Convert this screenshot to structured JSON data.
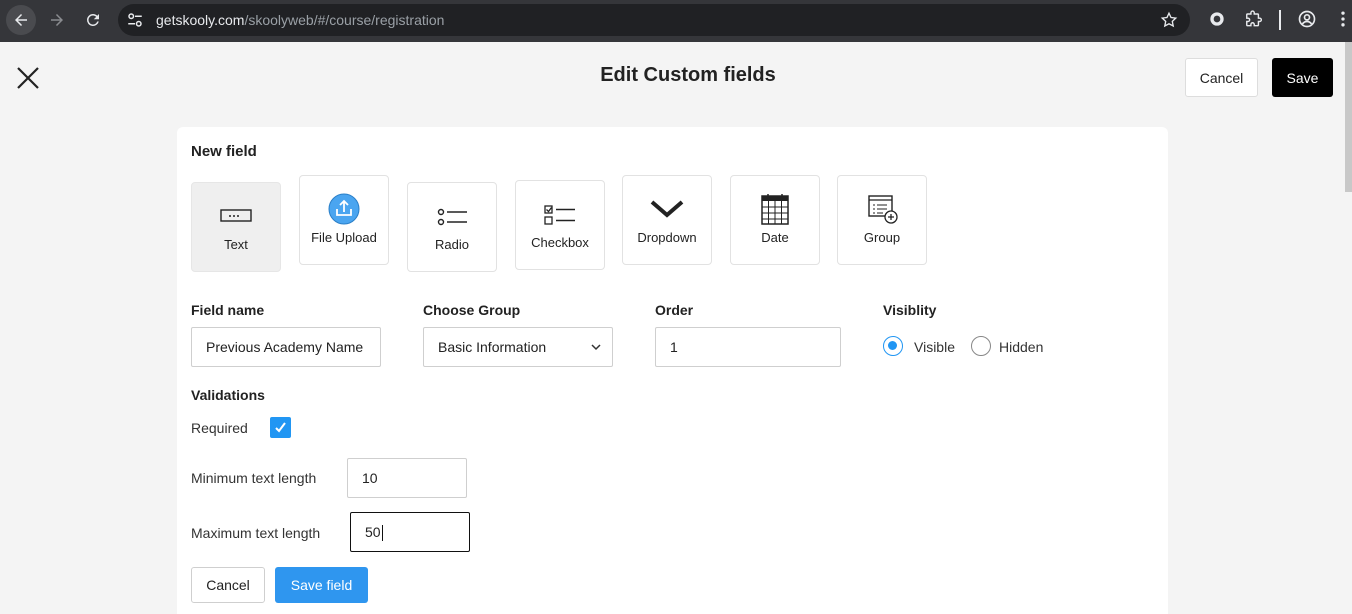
{
  "browser": {
    "url_host": "getskooly.com",
    "url_path": "/skoolyweb/#/course/registration"
  },
  "header": {
    "title": "Edit Custom fields",
    "cancel_label": "Cancel",
    "save_label": "Save"
  },
  "new_field": {
    "heading": "New field",
    "types": [
      {
        "label": "Text",
        "icon": "text-field-icon",
        "selected": true
      },
      {
        "label": "File Upload",
        "icon": "upload-icon"
      },
      {
        "label": "Radio",
        "icon": "radio-list-icon"
      },
      {
        "label": "Checkbox",
        "icon": "checkbox-list-icon"
      },
      {
        "label": "Dropdown",
        "icon": "chevron-down-icon"
      },
      {
        "label": "Date",
        "icon": "calendar-icon"
      },
      {
        "label": "Group",
        "icon": "group-add-icon"
      }
    ]
  },
  "form": {
    "field_name_label": "Field name",
    "field_name_value": "Previous Academy Name",
    "group_label": "Choose Group",
    "group_value": "Basic Information",
    "order_label": "Order",
    "order_value": "1",
    "visibility_label": "Visiblity",
    "visible_label": "Visible",
    "hidden_label": "Hidden",
    "visibility_selected": "Visible"
  },
  "validations": {
    "heading": "Validations",
    "required_label": "Required",
    "required_checked": true,
    "min_label": "Minimum text length",
    "min_value": "10",
    "max_label": "Maximum text length",
    "max_value": "50"
  },
  "actions": {
    "cancel_label": "Cancel",
    "save_label": "Save field"
  },
  "colors": {
    "accent": "#2196f3",
    "primary_button": "#2f96ef",
    "header_save": "#000000"
  }
}
